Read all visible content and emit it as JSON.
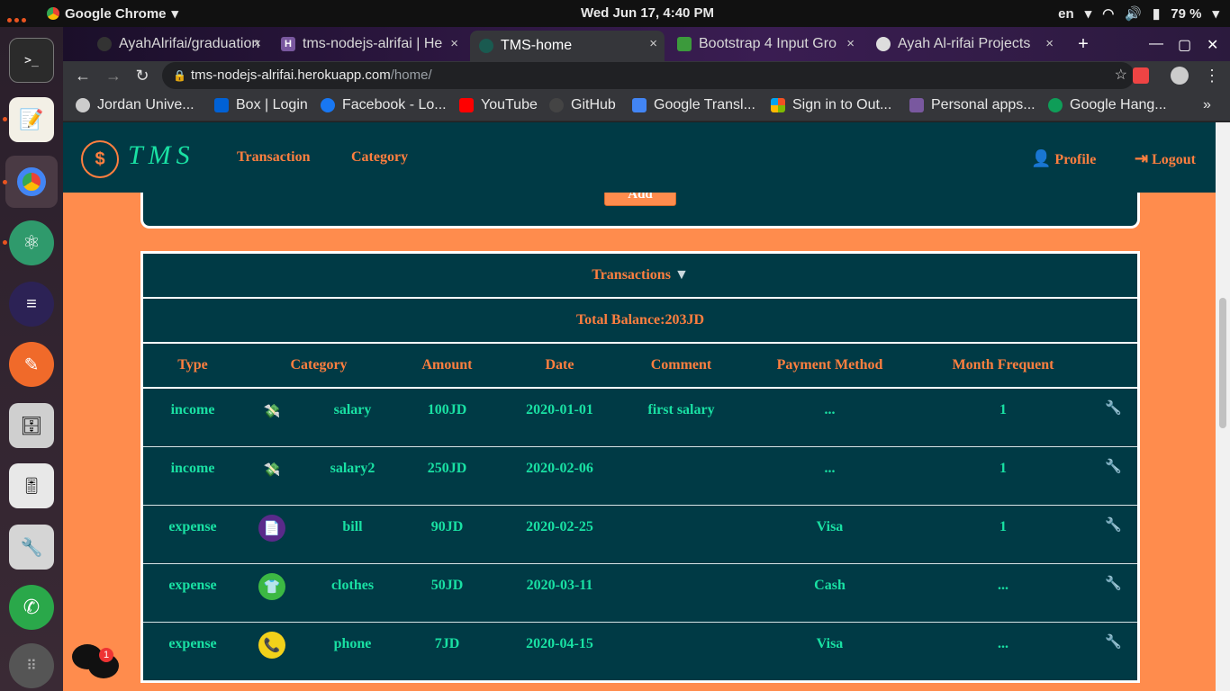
{
  "os": {
    "app_name": "Google Chrome",
    "clock": "Wed Jun 17,  4:40 PM",
    "lang": "en",
    "battery": "79 %",
    "chat_badge": "1"
  },
  "tabs": [
    {
      "title": "AyahAlrifai/graduation",
      "close": "×"
    },
    {
      "title": "tms-nodejs-alrifai | He",
      "close": "×"
    },
    {
      "title": "TMS-home",
      "close": "×"
    },
    {
      "title": "Bootstrap 4 Input Gro",
      "close": "×"
    },
    {
      "title": "Ayah Al-rifai Projects",
      "close": "×"
    }
  ],
  "url": {
    "host": "tms-nodejs-alrifai.herokuapp.com",
    "path": "/home/"
  },
  "bookmarks": [
    "Jordan Unive...",
    "Box | Login",
    "Facebook - Lo...",
    "YouTube",
    "GitHub",
    "Google Transl...",
    "Sign in to Out...",
    "Personal apps...",
    "Google Hang..."
  ],
  "app": {
    "brand": "TMS",
    "logo_symbol": "$",
    "nav": {
      "transaction": "Transaction",
      "category": "Category",
      "profile": "Profile",
      "logout": "Logout"
    },
    "add_button": "Add",
    "transactions_title": "Transactions",
    "total_balance": "Total Balance:203JD",
    "columns": [
      "Type",
      "Category",
      "Amount",
      "Date",
      "Comment",
      "Payment Method",
      "Month Frequent"
    ],
    "rows": [
      {
        "type": "income",
        "icon": "money-hand-icon",
        "category": "salary",
        "amount": "100JD",
        "date": "2020-01-01",
        "comment": "first salary",
        "payment": "...",
        "frequent": "1"
      },
      {
        "type": "income",
        "icon": "money-hand-icon",
        "category": "salary2",
        "amount": "250JD",
        "date": "2020-02-06",
        "comment": "",
        "payment": "...",
        "frequent": "1"
      },
      {
        "type": "expense",
        "icon": "bill-icon",
        "category": "bill",
        "amount": "90JD",
        "date": "2020-02-25",
        "comment": "",
        "payment": "Visa",
        "frequent": "1"
      },
      {
        "type": "expense",
        "icon": "shirt-icon",
        "category": "clothes",
        "amount": "50JD",
        "date": "2020-03-11",
        "comment": "",
        "payment": "Cash",
        "frequent": "..."
      },
      {
        "type": "expense",
        "icon": "phone-icon",
        "category": "phone",
        "amount": "7JD",
        "date": "2020-04-15",
        "comment": "",
        "payment": "Visa",
        "frequent": "..."
      }
    ]
  },
  "colors": {
    "navbar": "#003a45",
    "accent": "#ff7f3f",
    "text_green": "#19e0a3",
    "page_bg": "#ff8c4d"
  }
}
